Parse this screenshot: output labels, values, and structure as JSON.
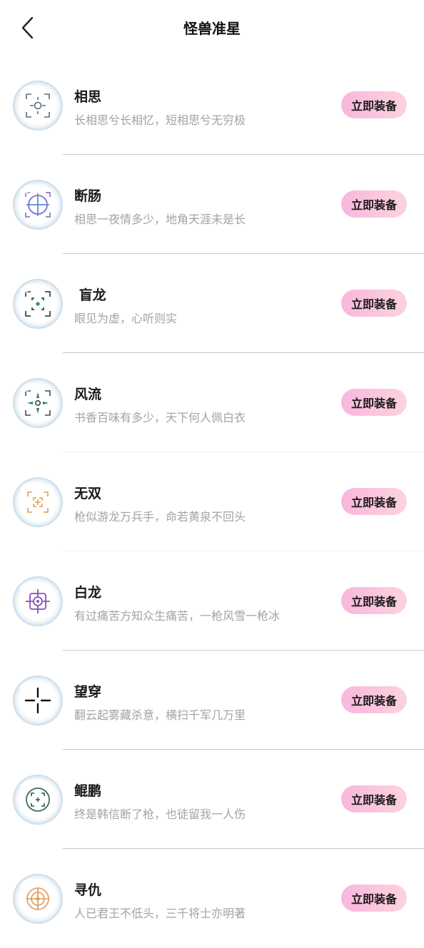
{
  "header": {
    "title": "怪兽准星",
    "back_icon": "chevron-left-icon"
  },
  "items": [
    {
      "name": "相思",
      "desc": "长相思兮长相忆，短相思兮无穷极",
      "button": "立即装备",
      "icon": "crosshair-corners-circle-icon"
    },
    {
      "name": "断肠",
      "desc": "相思一夜情多少，地角天涯未是长",
      "button": "立即装备",
      "icon": "crosshair-circle-plus-icon"
    },
    {
      "name": " 盲龙",
      "desc": "眼见为虚，心听则实",
      "button": "立即装备",
      "icon": "crosshair-corners-dot-icon"
    },
    {
      "name": "风流",
      "desc": "书香百味有多少，天下何人佩白衣",
      "button": "立即装备",
      "icon": "crosshair-blades-icon"
    },
    {
      "name": "无双",
      "desc": "枪似游龙万兵手，命若黄泉不回头",
      "button": "立即装备",
      "icon": "crosshair-orange-corners-icon"
    },
    {
      "name": "白龙",
      "desc": "有过痛苦方知众生痛苦，一枪风雪一枪冰",
      "button": "立即装备",
      "icon": "crosshair-purple-square-icon"
    },
    {
      "name": "望穿",
      "desc": "翻云起雾藏杀意，横扫千军几万里",
      "button": "立即装备",
      "icon": "crosshair-black-cross-icon"
    },
    {
      "name": "鲲鹏",
      "desc": "终是韩信断了枪，也徒留我一人伤",
      "button": "立即装备",
      "icon": "crosshair-green-ring-icon"
    },
    {
      "name": "寻仇",
      "desc": "人已君王不低头，三千将士亦明著",
      "button": "立即装备",
      "icon": "crosshair-orange-rings-icon"
    }
  ]
}
